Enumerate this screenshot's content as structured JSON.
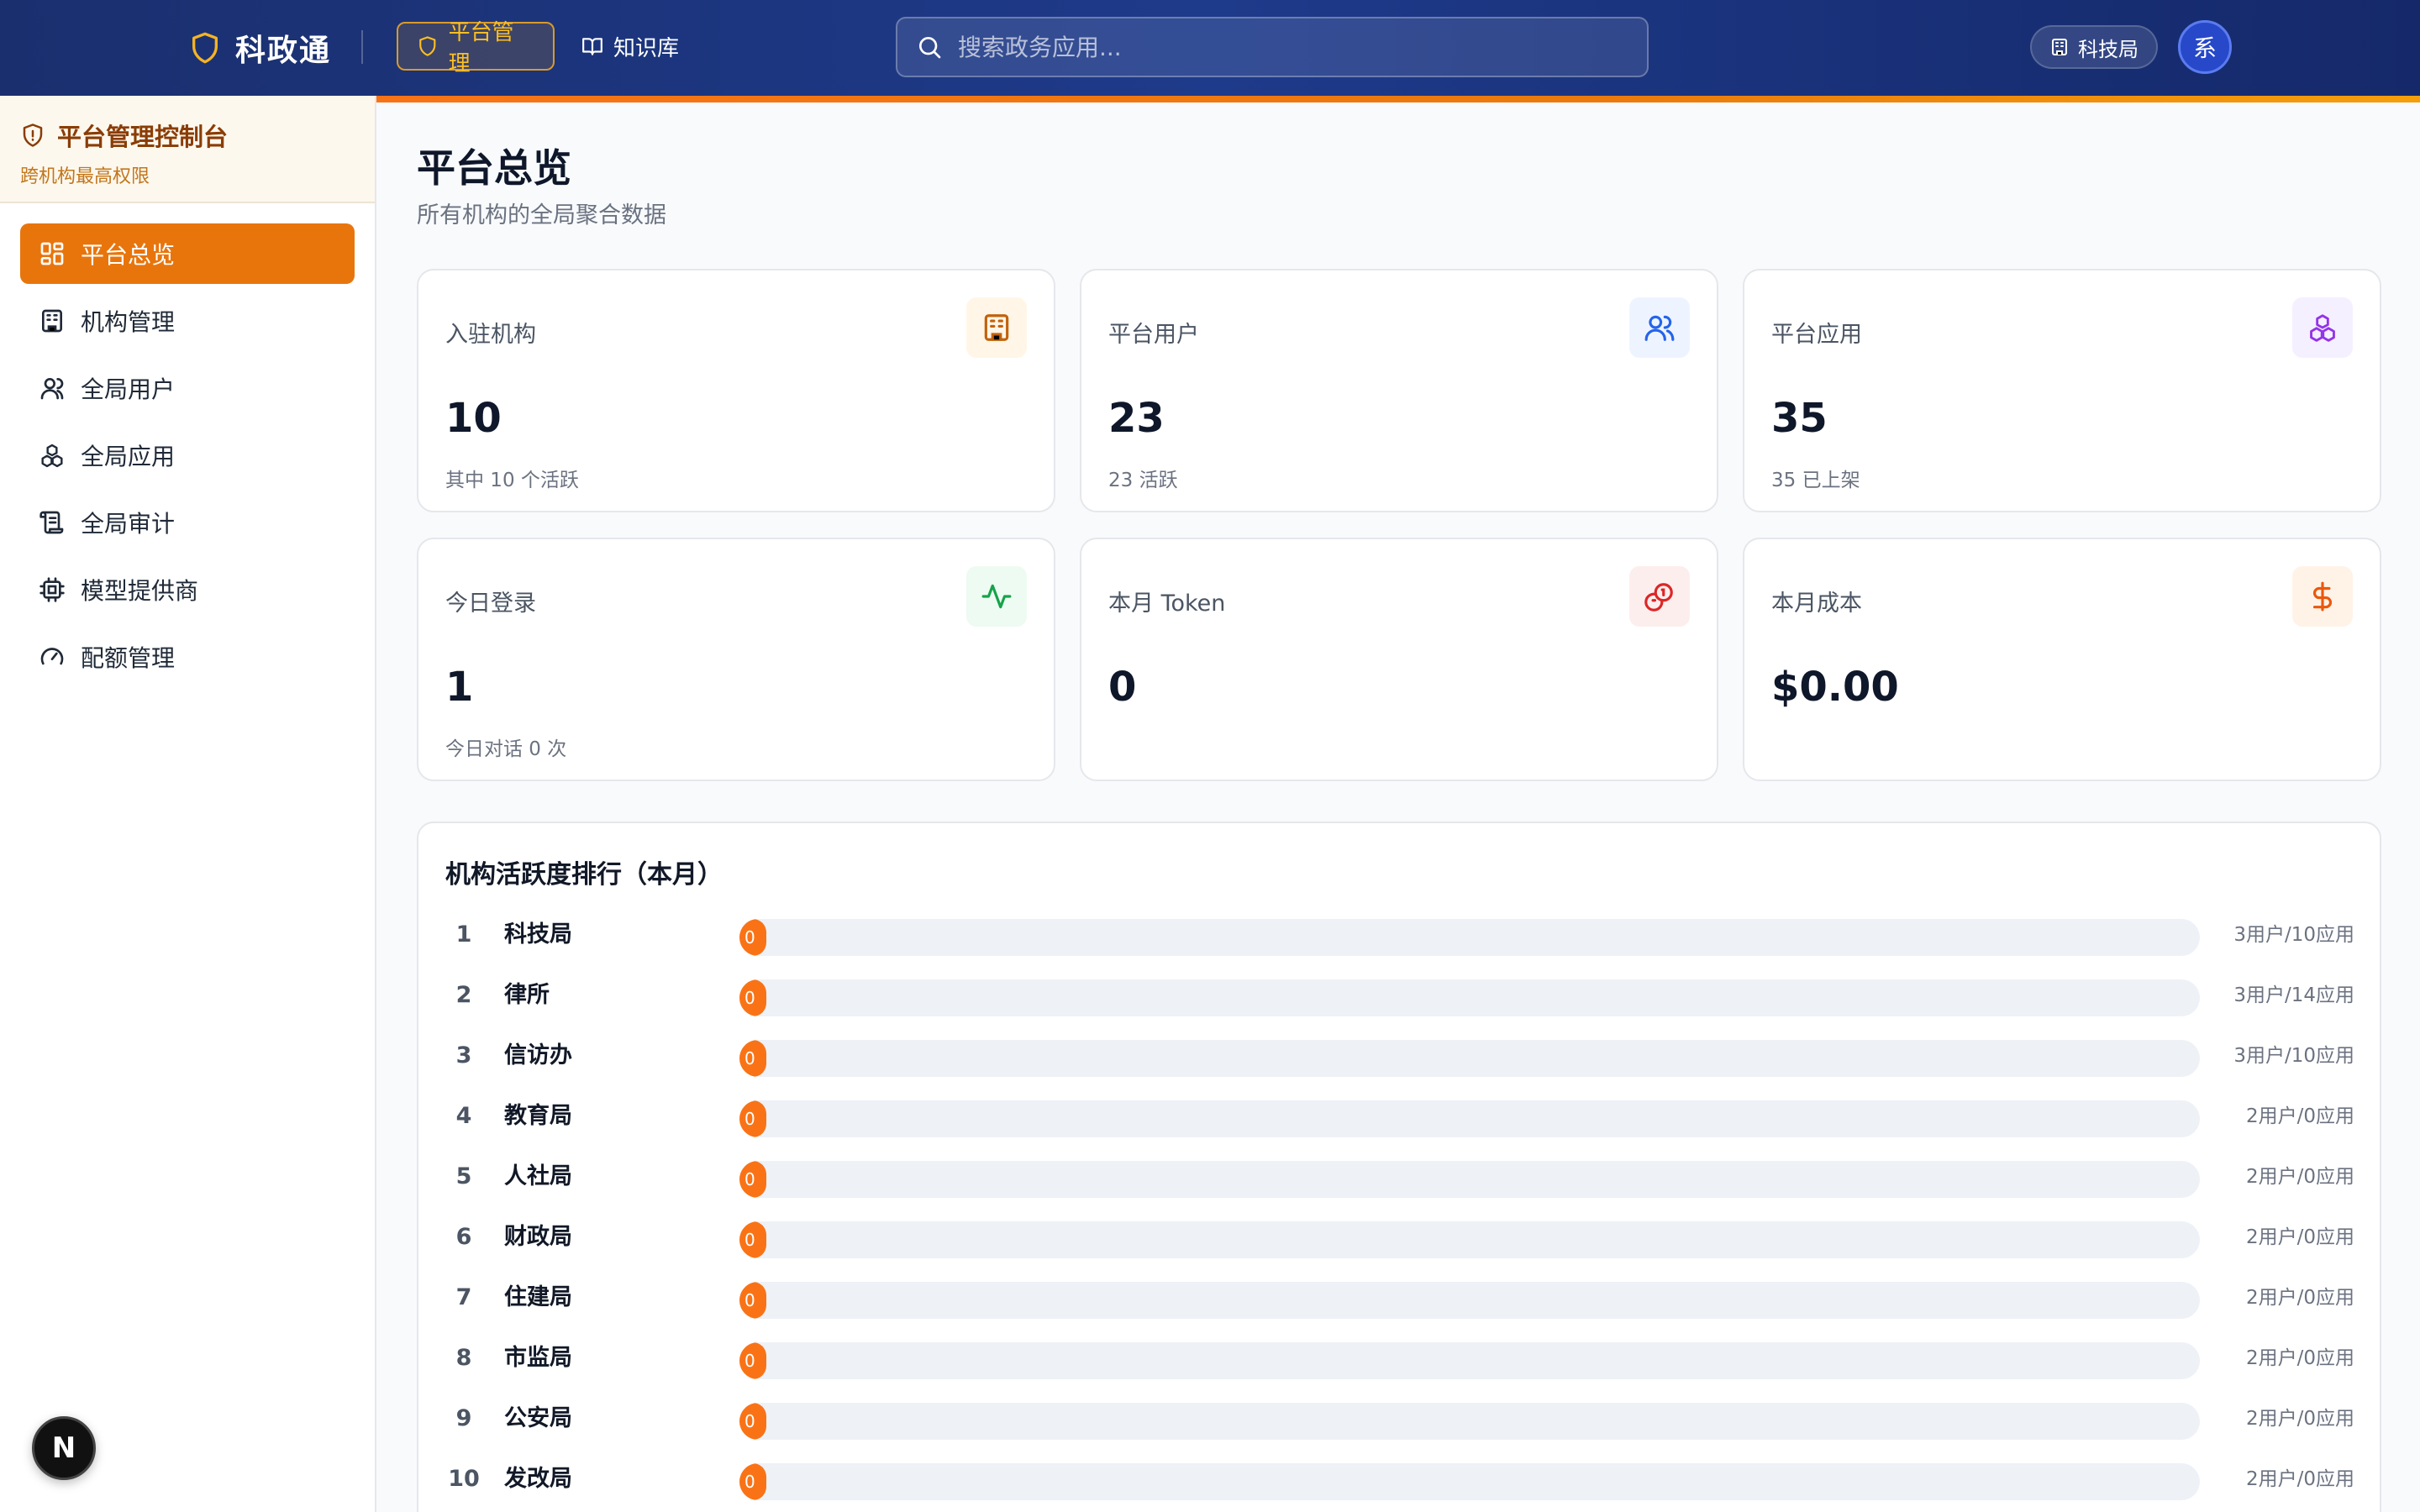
{
  "app": {
    "name": "科政通"
  },
  "nav": {
    "platform": "平台管理",
    "knowledge": "知识库"
  },
  "search": {
    "placeholder": "搜索政务应用..."
  },
  "org_chip": "科技局",
  "avatar_text": "系",
  "sidebar": {
    "title": "平台管理控制台",
    "subtitle": "跨机构最高权限",
    "items": [
      {
        "label": "平台总览",
        "icon": "dashboard-icon"
      },
      {
        "label": "机构管理",
        "icon": "building-icon"
      },
      {
        "label": "全局用户",
        "icon": "user-icon"
      },
      {
        "label": "全局应用",
        "icon": "boxes-icon"
      },
      {
        "label": "全局审计",
        "icon": "scroll-icon"
      },
      {
        "label": "模型提供商",
        "icon": "cpu-icon"
      },
      {
        "label": "配额管理",
        "icon": "gauge-icon"
      }
    ]
  },
  "page": {
    "title": "平台总览",
    "subtitle": "所有机构的全局聚合数据"
  },
  "stats": [
    {
      "label": "入驻机构",
      "value": "10",
      "sub": "其中 10 个活跃",
      "icon": "building-icon",
      "color": "#c2620a",
      "bg": "#fff6e8"
    },
    {
      "label": "平台用户",
      "value": "23",
      "sub": "23 活跃",
      "icon": "users-icon",
      "color": "#2563eb",
      "bg": "#eef4ff"
    },
    {
      "label": "平台应用",
      "value": "35",
      "sub": "35 已上架",
      "icon": "boxes-icon",
      "color": "#9333ea",
      "bg": "#f5f0ff"
    },
    {
      "label": "今日登录",
      "value": "1",
      "sub": "今日对话 0 次",
      "icon": "activity-icon",
      "color": "#16a34a",
      "bg": "#edfbf2"
    },
    {
      "label": "本月 Token",
      "value": "0",
      "sub": "",
      "icon": "coins-icon",
      "color": "#dc2626",
      "bg": "#fdeeee"
    },
    {
      "label": "本月成本",
      "value": "$0.00",
      "sub": "",
      "icon": "dollar-icon",
      "color": "#ea580c",
      "bg": "#fff3e8"
    }
  ],
  "ranking": {
    "title": "机构活跃度排行（本月）",
    "rows": [
      {
        "rank": "1",
        "name": "科技局",
        "value": 0,
        "label": "0",
        "meta": "3用户/10应用"
      },
      {
        "rank": "2",
        "name": "律所",
        "value": 0,
        "label": "0",
        "meta": "3用户/14应用"
      },
      {
        "rank": "3",
        "name": "信访办",
        "value": 0,
        "label": "0",
        "meta": "3用户/10应用"
      },
      {
        "rank": "4",
        "name": "教育局",
        "value": 0,
        "label": "0",
        "meta": "2用户/0应用"
      },
      {
        "rank": "5",
        "name": "人社局",
        "value": 0,
        "label": "0",
        "meta": "2用户/0应用"
      },
      {
        "rank": "6",
        "name": "财政局",
        "value": 0,
        "label": "0",
        "meta": "2用户/0应用"
      },
      {
        "rank": "7",
        "name": "住建局",
        "value": 0,
        "label": "0",
        "meta": "2用户/0应用"
      },
      {
        "rank": "8",
        "name": "市监局",
        "value": 0,
        "label": "0",
        "meta": "2用户/0应用"
      },
      {
        "rank": "9",
        "name": "公安局",
        "value": 0,
        "label": "0",
        "meta": "2用户/0应用"
      },
      {
        "rank": "10",
        "name": "发改局",
        "value": 0,
        "label": "0",
        "meta": "2用户/0应用"
      }
    ]
  },
  "dev_badge": "N"
}
